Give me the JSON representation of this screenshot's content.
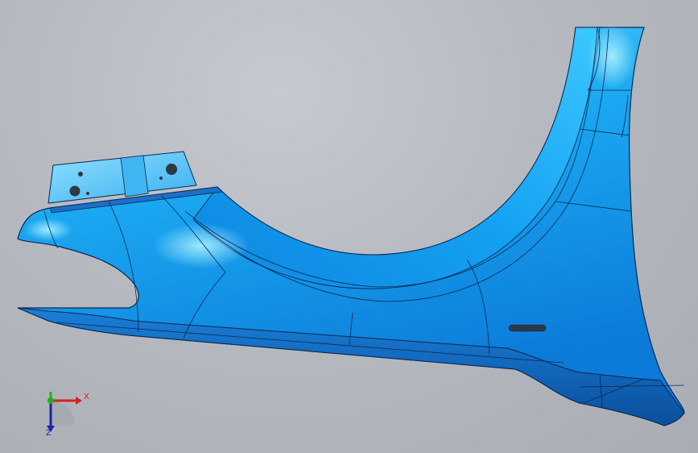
{
  "viewport": {
    "background_top": "#c6cad0",
    "background_bottom": "#a9adb3"
  },
  "model": {
    "part": "fender-panel",
    "surface_color": "#1aa7f0",
    "surface_highlight": "#7fe3ff",
    "surface_shadow": "#0a62b8",
    "edge_color": "#0b2850",
    "bracket_color": "#5cc2f5"
  },
  "triad": {
    "x_label": "X",
    "z_label": "Z",
    "x_color": "#d62020",
    "y_color": "#20b020",
    "z_color": "#2020b0"
  }
}
